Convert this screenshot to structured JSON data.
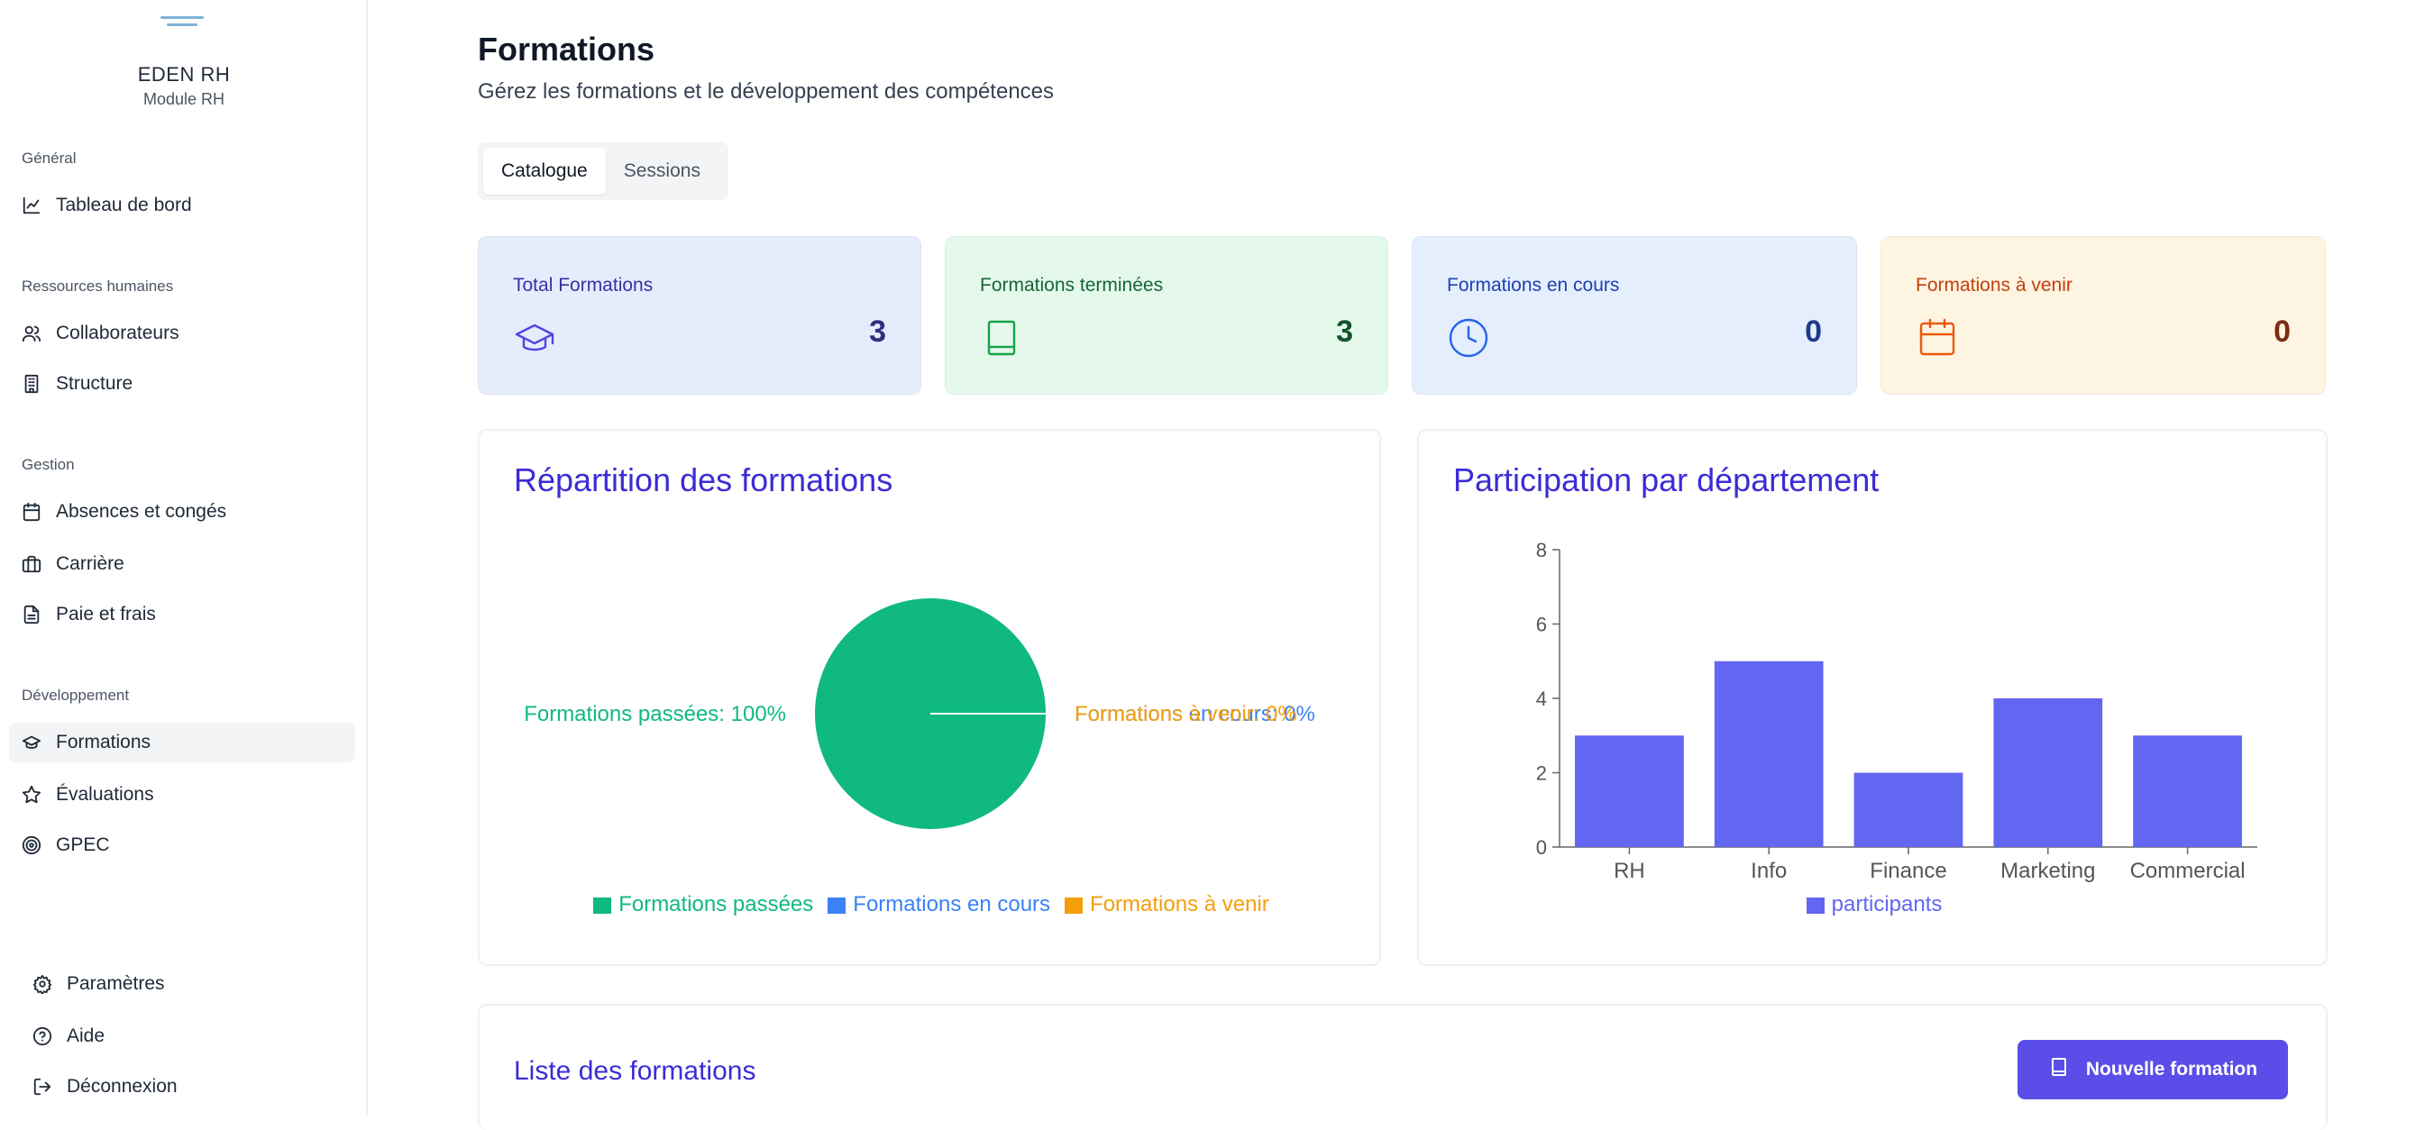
{
  "sidebar": {
    "brand_name": "EDEN RH",
    "brand_sub": "Module RH",
    "sections": {
      "general": "Général",
      "rh": "Ressources humaines",
      "gestion": "Gestion",
      "dev": "Développement"
    },
    "items": {
      "dashboard": "Tableau de bord",
      "collaborateurs": "Collaborateurs",
      "structure": "Structure",
      "absences": "Absences et congés",
      "carriere": "Carrière",
      "paie": "Paie et frais",
      "formations": "Formations",
      "evaluations": "Évaluations",
      "gpec": "GPEC",
      "parametres": "Paramètres",
      "aide": "Aide",
      "deconnexion": "Déconnexion"
    }
  },
  "header": {
    "title": "Formations",
    "subtitle": "Gérez les formations et le développement des compétences"
  },
  "tabs": [
    "Catalogue",
    "Sessions"
  ],
  "stats": [
    {
      "label": "Total Formations",
      "value": "3",
      "icon": "graduation-cap-icon",
      "label_color": "#3730a3",
      "value_color": "#312e81",
      "icon_color": "#4f46e5",
      "bg": "#e7ecfd"
    },
    {
      "label": "Formations terminées",
      "value": "3",
      "icon": "book-icon",
      "label_color": "#166534",
      "value_color": "#14532d",
      "icon_color": "#16a34a",
      "bg": "#e4f9ec"
    },
    {
      "label": "Formations en cours",
      "value": "0",
      "icon": "clock-icon",
      "label_color": "#1e40af",
      "value_color": "#1e3a8a",
      "icon_color": "#2563eb",
      "bg": "#e5eefd"
    },
    {
      "label": "Formations à venir",
      "value": "0",
      "icon": "calendar-icon",
      "label_color": "#c2410c",
      "value_color": "#7c2d12",
      "icon_color": "#ea580c",
      "bg": "#fef4e2"
    }
  ],
  "pie_panel": {
    "title": "Répartition des formations"
  },
  "bar_panel": {
    "title": "Participation par département"
  },
  "list_panel": {
    "title": "Liste des formations",
    "button_label": "Nouvelle formation"
  },
  "colors": {
    "accent": "#5b4de8",
    "pie_green": "#10b981",
    "blue": "#3b82f6",
    "orange": "#f59e0b",
    "bar": "#6366f1"
  },
  "chart_data": [
    {
      "type": "pie",
      "title": "Répartition des formations",
      "slices": [
        {
          "name": "Formations passées",
          "value": 100,
          "label": "Formations passées: 100%",
          "color": "#10b981"
        },
        {
          "name": "Formations en cours",
          "value": 0,
          "label": "Formations en cours: 0%",
          "color": "#3b82f6"
        },
        {
          "name": "Formations à venir",
          "value": 0,
          "label": "Formations à venir: 0%",
          "color": "#f59e0b"
        }
      ],
      "legend": [
        "Formations passées",
        "Formations en cours",
        "Formations à venir"
      ],
      "legend_position": "bottom"
    },
    {
      "type": "bar",
      "title": "Participation par département",
      "categories": [
        "RH",
        "Info",
        "Finance",
        "Marketing",
        "Commercial"
      ],
      "series": [
        {
          "name": "participants",
          "values": [
            3,
            5,
            2,
            4,
            3
          ]
        }
      ],
      "ylim": [
        0,
        8
      ],
      "yticks": [
        "0",
        "2",
        "4",
        "6",
        "8"
      ],
      "grid": false,
      "legend_position": "bottom"
    }
  ]
}
